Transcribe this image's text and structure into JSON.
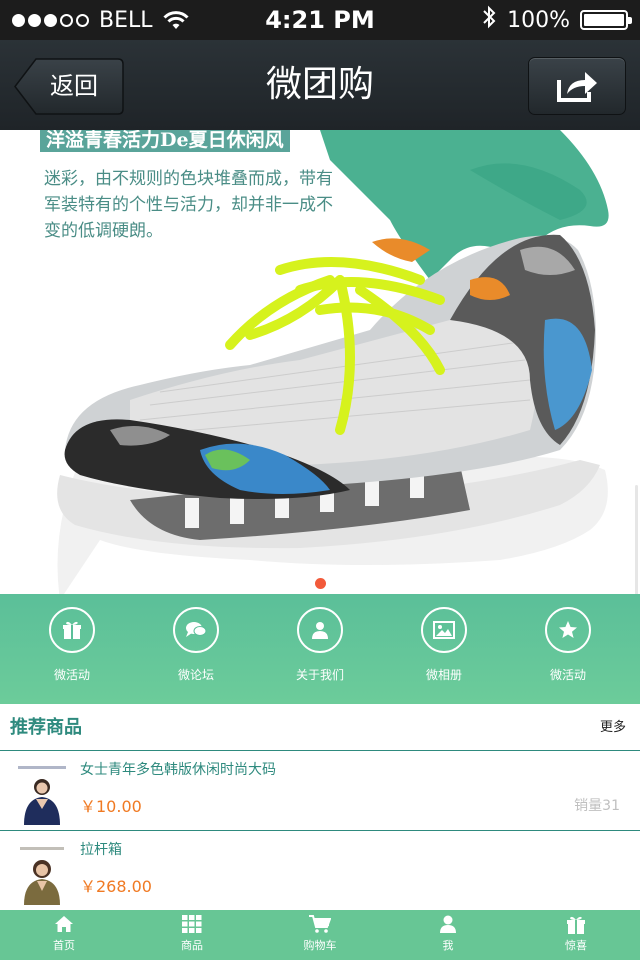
{
  "status_bar": {
    "carrier": "BELL",
    "time": "4:21 PM",
    "battery": "100%",
    "signal_dots_filled": 3,
    "signal_dots_total": 5
  },
  "nav": {
    "back_label": "返回",
    "title": "微团购"
  },
  "banner": {
    "heading": "洋溢青春活力De夏日休闲风",
    "text": "迷彩，由不规则的色块堆叠而成，带有军装特有的个性与活力，却并非一成不变的低调硬朗。",
    "slide_count": 1,
    "active_slide": 1
  },
  "menu": {
    "items": [
      {
        "label": "微活动",
        "icon": "gift-icon"
      },
      {
        "label": "微论坛",
        "icon": "chat-icon"
      },
      {
        "label": "关于我们",
        "icon": "user-icon"
      },
      {
        "label": "微相册",
        "icon": "picture-icon"
      },
      {
        "label": "微活动",
        "icon": "star-icon"
      }
    ]
  },
  "recommend": {
    "title": "推荐商品",
    "more": "更多",
    "products": [
      {
        "name": "女士青年多色韩版休闲时尚大码",
        "price": "￥10.00",
        "sales": "销量31"
      },
      {
        "name": "拉杆箱",
        "price": "￥268.00",
        "sales": ""
      }
    ]
  },
  "tabbar": {
    "items": [
      {
        "label": "首页",
        "icon": "home-icon"
      },
      {
        "label": "商品",
        "icon": "grid-icon"
      },
      {
        "label": "购物车",
        "icon": "cart-icon"
      },
      {
        "label": "我",
        "icon": "user-icon"
      },
      {
        "label": "惊喜",
        "icon": "gift-icon"
      }
    ]
  },
  "colors": {
    "menu_green": "#62c59a",
    "accent_teal": "#2e8a7e",
    "price_orange": "#f07a23",
    "slider_dot": "#f25a3a"
  }
}
